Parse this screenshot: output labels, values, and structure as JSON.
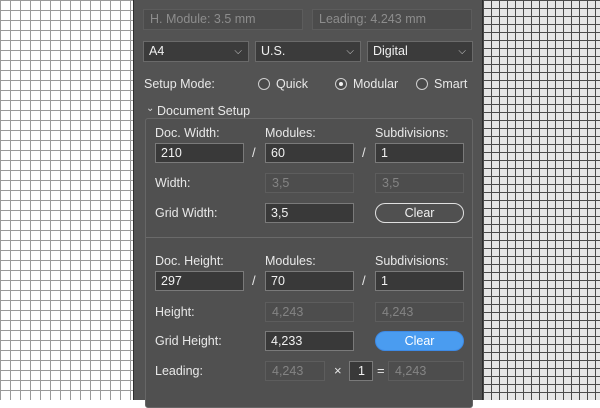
{
  "top": {
    "h_module": "H. Module: 3.5 mm",
    "leading": "Leading: 4.243 mm"
  },
  "selects": {
    "page_size": "A4",
    "units": "U.S.",
    "medium": "Digital"
  },
  "setup_mode": {
    "label": "Setup Mode:",
    "options": [
      "Quick",
      "Modular",
      "Smart"
    ],
    "selected": "Modular"
  },
  "document_setup": {
    "title": "Document Setup",
    "width": {
      "doc_label": "Doc. Width:",
      "modules_label": "Modules:",
      "subdivisions_label": "Subdivisions:",
      "doc_value": "210",
      "modules_value": "60",
      "subdivisions_value": "1",
      "result_label": "Width:",
      "result_value": "3,5",
      "result_sub_value": "3,5",
      "grid_label": "Grid Width:",
      "grid_value": "3,5",
      "clear_label": "Clear"
    },
    "height": {
      "doc_label": "Doc. Height:",
      "modules_label": "Modules:",
      "subdivisions_label": "Subdivisions:",
      "doc_value": "297",
      "modules_value": "70",
      "subdivisions_value": "1",
      "result_label": "Height:",
      "result_value": "4,243",
      "result_sub_value": "4,243",
      "grid_label": "Grid Height:",
      "grid_value": "4,233",
      "clear_label": "Clear",
      "leading_label": "Leading:",
      "leading_value": "4,243",
      "multiplier": "1",
      "leading_result": "4,243"
    },
    "separator": "/",
    "times": "×",
    "equals": "="
  }
}
